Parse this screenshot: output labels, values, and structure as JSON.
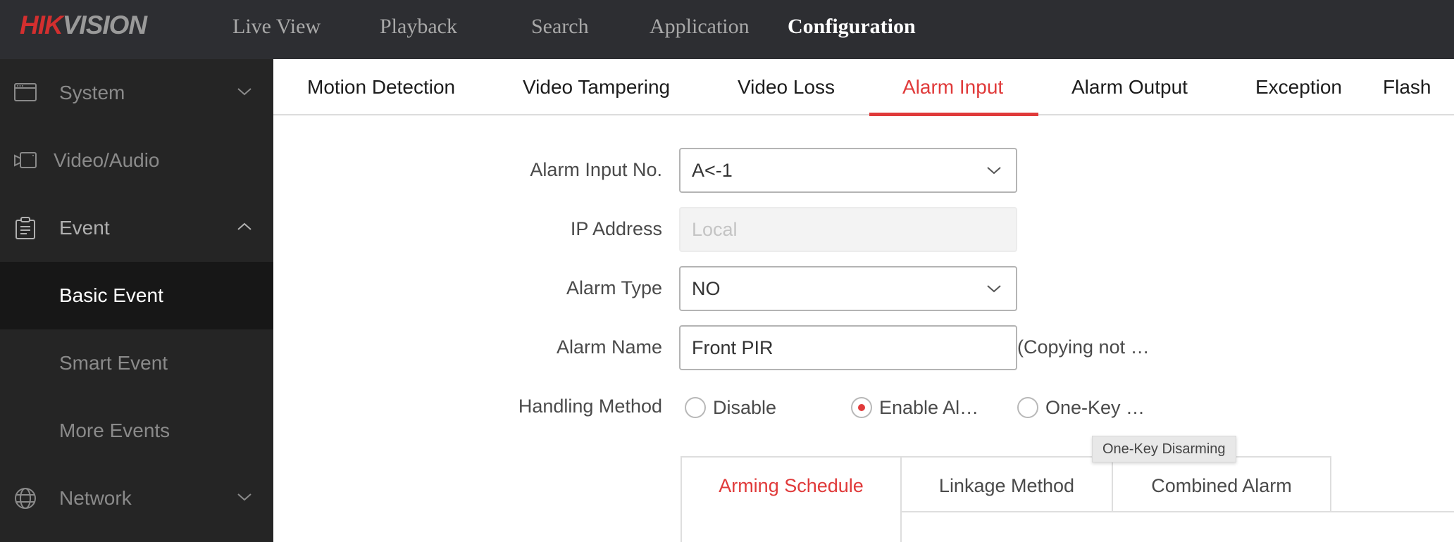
{
  "brand": {
    "logo_part1": "HIK",
    "logo_part2": "VISION"
  },
  "top_nav": [
    {
      "label": "Live View",
      "active": false
    },
    {
      "label": "Playback",
      "active": false
    },
    {
      "label": "Search",
      "active": false
    },
    {
      "label": "Application",
      "active": false
    },
    {
      "label": "Configuration",
      "active": true
    }
  ],
  "sidebar": {
    "items": [
      {
        "label": "System",
        "icon": "window-icon",
        "state": "collapsed"
      },
      {
        "label": "Video/Audio",
        "icon": "video-camera-icon",
        "state": "none"
      },
      {
        "label": "Event",
        "icon": "clipboard-icon",
        "state": "expanded"
      },
      {
        "label": "Basic Event",
        "sub": true,
        "selected": true
      },
      {
        "label": "Smart Event",
        "sub": true
      },
      {
        "label": "More Events",
        "sub": true
      },
      {
        "label": "Network",
        "icon": "globe-icon",
        "state": "collapsed"
      }
    ]
  },
  "tabs": [
    {
      "label": "Motion Detection"
    },
    {
      "label": "Video Tampering"
    },
    {
      "label": "Video Loss"
    },
    {
      "label": "Alarm Input",
      "active": true
    },
    {
      "label": "Alarm Output"
    },
    {
      "label": "Exception"
    },
    {
      "label": "Flash"
    }
  ],
  "form": {
    "alarm_input_no": {
      "label": "Alarm Input No.",
      "value": "A<-1"
    },
    "ip_address": {
      "label": "IP Address",
      "value": "Local"
    },
    "alarm_type": {
      "label": "Alarm Type",
      "value": "NO"
    },
    "alarm_name": {
      "label": "Alarm Name",
      "value": "Front PIR",
      "hint": "(Copying not …"
    },
    "handling_method": {
      "label": "Handling Method",
      "options": [
        {
          "label": "Disable",
          "checked": false
        },
        {
          "label": "Enable Al…",
          "checked": true
        },
        {
          "label": "One-Key …",
          "checked": false
        }
      ],
      "tooltip": "One-Key Disarming"
    }
  },
  "subtabs": [
    {
      "label": "Arming Schedule",
      "active": true
    },
    {
      "label": "Linkage Method"
    },
    {
      "label": "Combined Alarm"
    }
  ],
  "colors": {
    "accent": "#e03a3a",
    "header_bg": "#2d2e32",
    "sidebar_bg": "#252525",
    "sidebar_selected_bg": "#171717"
  }
}
